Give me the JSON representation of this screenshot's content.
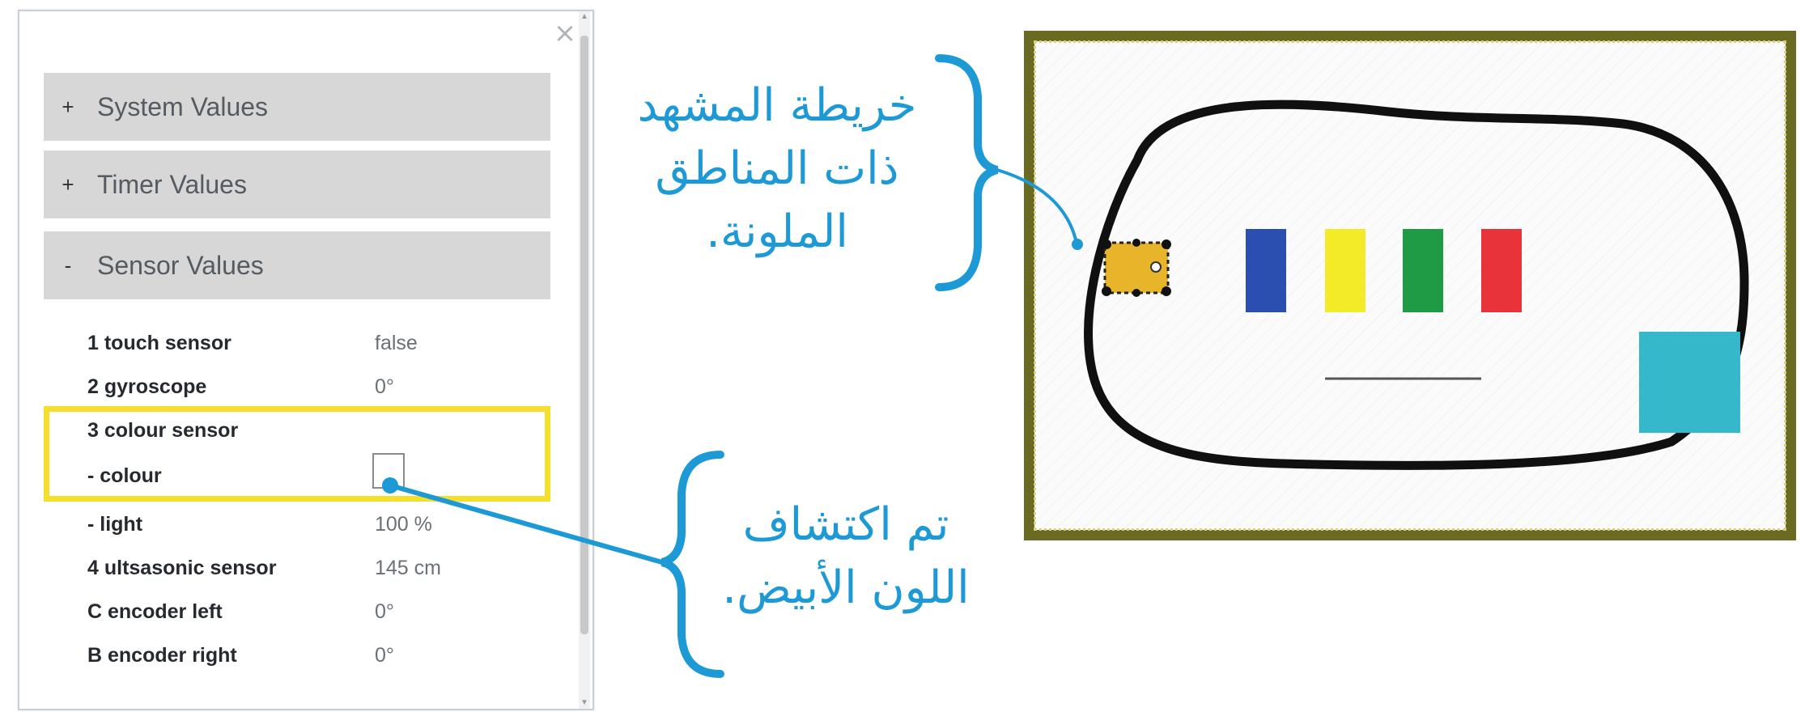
{
  "panel": {
    "close_glyph": "×",
    "sections": [
      {
        "symbol": "+",
        "label": "System Values"
      },
      {
        "symbol": "+",
        "label": "Timer Values"
      },
      {
        "symbol": "-",
        "label": "Sensor Values"
      }
    ],
    "sensor_rows": [
      {
        "name": "1 touch sensor",
        "value": "false"
      },
      {
        "name": "2 gyroscope",
        "value": "0°"
      },
      {
        "name": "3 colour sensor",
        "value": ""
      },
      {
        "name": "- colour",
        "value": ""
      },
      {
        "name": "- light",
        "value": "100 %"
      },
      {
        "name": "4 ultsasonic sensor",
        "value": "145 cm"
      },
      {
        "name": "C encoder left",
        "value": "0°"
      },
      {
        "name": "B encoder right",
        "value": "0°"
      }
    ],
    "detected_colour": "#ffffff"
  },
  "callouts": {
    "map_label": [
      "خريطة المشهد",
      "ذات المناطق",
      "الملونة."
    ],
    "colour_label": [
      "تم اكتشاف",
      "اللون الأبيض."
    ]
  },
  "map": {
    "robot_color": "#e8b52a",
    "zones": [
      {
        "name": "blue",
        "color": "#2a4fb0"
      },
      {
        "name": "yellow",
        "color": "#f3ea28"
      },
      {
        "name": "green",
        "color": "#1f9a45"
      },
      {
        "name": "red",
        "color": "#e8333a"
      }
    ],
    "target_color": "#35b8c9",
    "frame_color": "#6b6a22",
    "accent_color": "#1d9ad6",
    "highlight_color": "#f4df2c"
  }
}
